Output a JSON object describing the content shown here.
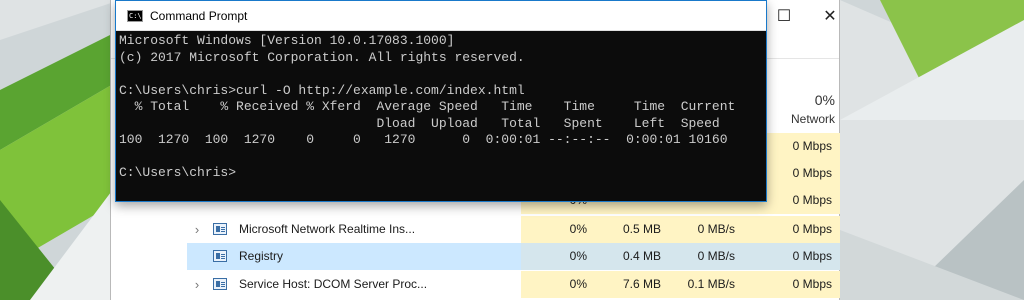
{
  "cmd": {
    "title": "Command Prompt",
    "icon_text": "C:\\",
    "lines": [
      "Microsoft Windows [Version 10.0.17083.1000]",
      "(c) 2017 Microsoft Corporation. All rights reserved.",
      "",
      "C:\\Users\\chris>curl -O http://example.com/index.html",
      "  % Total    % Received % Xferd  Average Speed   Time    Time     Time  Current",
      "                                 Dload  Upload   Total   Spent    Left  Speed",
      "100  1270  100  1270    0     0   1270      0  0:00:01 --:--:--  0:00:01 10160",
      "",
      "C:\\Users\\chris>"
    ]
  },
  "task_manager": {
    "controls": {
      "maximize": "☐",
      "close": "✕"
    },
    "network_column": {
      "percent": "0%",
      "label": "Network"
    },
    "rows": [
      {
        "expand": "",
        "name": "",
        "cpu": "",
        "memory": "",
        "disk": "",
        "network": "0 Mbps",
        "selected": false
      },
      {
        "expand": "",
        "name": "",
        "cpu": "",
        "memory": "",
        "disk": "",
        "network": "0 Mbps",
        "selected": false
      },
      {
        "expand": "",
        "name": "",
        "cpu": "0%",
        "memory": "",
        "disk": "",
        "network": "0 Mbps",
        "selected": false
      },
      {
        "expand": "›",
        "name": "Microsoft Network Realtime Ins...",
        "cpu": "0%",
        "memory": "0.5 MB",
        "disk": "0 MB/s",
        "network": "0 Mbps",
        "selected": false
      },
      {
        "expand": "",
        "name": "Registry",
        "cpu": "0%",
        "memory": "0.4 MB",
        "disk": "0 MB/s",
        "network": "0 Mbps",
        "selected": true
      },
      {
        "expand": "›",
        "name": "Service Host: DCOM Server Proc...",
        "cpu": "0%",
        "memory": "7.6 MB",
        "disk": "0.1 MB/s",
        "network": "0 Mbps",
        "selected": false
      }
    ]
  },
  "colors": {
    "accent": "#1979ca",
    "background_green_dark": "#3a8a2a",
    "background_green_light": "#7fc23a",
    "column_highlight": "#fff4c4",
    "row_selected": "#cce8ff"
  }
}
